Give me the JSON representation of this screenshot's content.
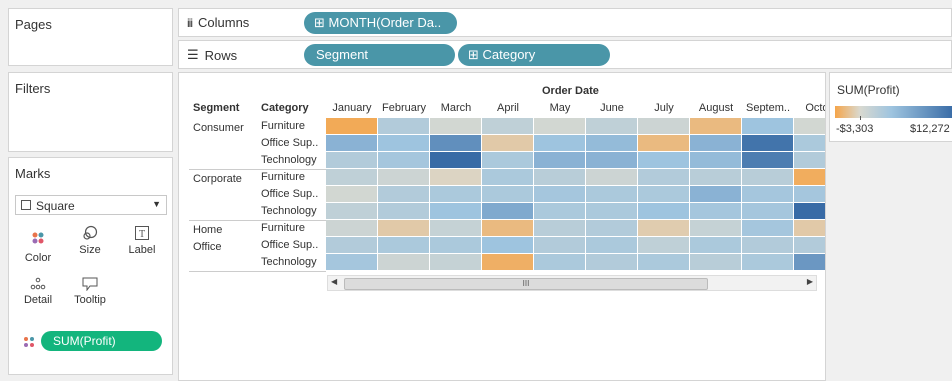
{
  "shelves": {
    "pages_title": "Pages",
    "columns_label": "Columns",
    "rows_label": "Rows",
    "columns_pills": [
      "⊞ MONTH(Order Da.."
    ],
    "rows_pills": [
      "Segment",
      "⊞ Category"
    ]
  },
  "filters": {
    "title": "Filters"
  },
  "marks": {
    "title": "Marks",
    "type_value": "Square",
    "buttons": [
      {
        "label": "Color",
        "icon": "color-dots-icon"
      },
      {
        "label": "Size",
        "icon": "size-icon"
      },
      {
        "label": "Label",
        "icon": "label-icon"
      },
      {
        "label": "Detail",
        "icon": "detail-icon"
      },
      {
        "label": "Tooltip",
        "icon": "tooltip-icon"
      }
    ],
    "measure_pill": "SUM(Profit)"
  },
  "legend": {
    "title": "SUM(Profit)",
    "min_label": "-$3,303",
    "max_label": "$12,272",
    "colors": {
      "neg": "#f5a54a",
      "mid": "#d9d9d0",
      "pos": "#2e62a0"
    }
  },
  "view": {
    "column_field": "Order Date",
    "segment_header": "Segment",
    "category_header": "Category",
    "months": [
      "January",
      "February",
      "March",
      "April",
      "May",
      "June",
      "July",
      "August",
      "Septem..",
      "Octob"
    ],
    "segments": [
      {
        "label": "Consumer",
        "categories": [
          "Furniture",
          "Office Sup..",
          "Technology"
        ]
      },
      {
        "label": "Corporate",
        "categories": [
          "Furniture",
          "Office Sup..",
          "Technology"
        ]
      },
      {
        "label": "Home Office",
        "categories": [
          "Furniture",
          "Office Sup..",
          "Technology"
        ]
      }
    ],
    "scrollbar_thumb": "III"
  },
  "chart_data": {
    "type": "heatmap",
    "x": [
      "January",
      "February",
      "March",
      "April",
      "May",
      "June",
      "July",
      "August",
      "Septem..",
      "Octob"
    ],
    "rows": [
      "Consumer / Furniture",
      "Consumer / Office Sup..",
      "Consumer / Technology",
      "Corporate / Furniture",
      "Corporate / Office Sup..",
      "Corporate / Technology",
      "Home Office / Furniture",
      "Home Office / Office Sup..",
      "Home Office / Technology"
    ],
    "values": [
      [
        -0.9,
        0.3,
        0.05,
        0.2,
        0.05,
        0.2,
        0.1,
        -0.6,
        0.45,
        0.05
      ],
      [
        0.55,
        0.45,
        0.75,
        -0.3,
        0.45,
        0.5,
        -0.6,
        0.55,
        0.9,
        0.35
      ],
      [
        0.3,
        0.4,
        0.95,
        0.35,
        0.55,
        0.55,
        0.45,
        0.5,
        0.85,
        0.3
      ],
      [
        0.2,
        0.1,
        -0.1,
        0.35,
        0.25,
        0.1,
        0.3,
        0.25,
        0.25,
        -0.85
      ],
      [
        0.05,
        0.3,
        0.35,
        0.35,
        0.4,
        0.35,
        0.35,
        0.55,
        0.4,
        0.4
      ],
      [
        0.2,
        0.3,
        0.45,
        0.6,
        0.35,
        0.35,
        0.45,
        0.4,
        0.4,
        0.95
      ],
      [
        0.1,
        -0.3,
        0.15,
        -0.6,
        0.25,
        0.3,
        -0.25,
        0.15,
        0.4,
        -0.3
      ],
      [
        0.3,
        0.35,
        0.35,
        0.45,
        0.3,
        0.35,
        0.2,
        0.35,
        0.3,
        0.3
      ],
      [
        0.4,
        0.1,
        0.15,
        -0.8,
        0.35,
        0.3,
        0.35,
        0.25,
        0.35,
        0.7
      ]
    ],
    "color_range": [
      "-$3,303",
      "$12,272"
    ]
  }
}
